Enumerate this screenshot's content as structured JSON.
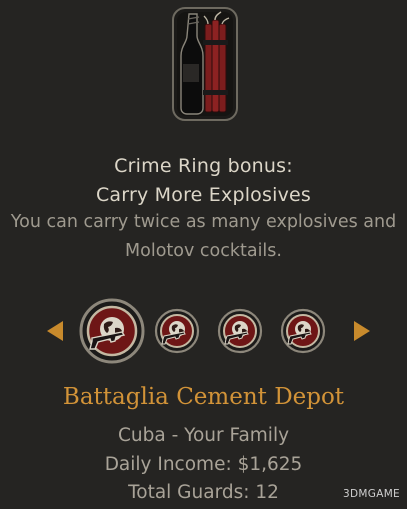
{
  "bonus": {
    "icon": "explosives-icon",
    "title_line1": "Crime Ring bonus:",
    "title_line2": "Carry More Explosives",
    "desc_line1": "You can carry twice as many explosives and",
    "desc_line2": "Molotov cocktails."
  },
  "carousel": {
    "prev_icon": "arrow-left-icon",
    "next_icon": "arrow-right-icon",
    "items": [
      {
        "icon": "racket-globe-gun-icon",
        "selected": true
      },
      {
        "icon": "racket-globe-gun-icon",
        "selected": false
      },
      {
        "icon": "racket-globe-gun-icon",
        "selected": false
      },
      {
        "icon": "racket-globe-gun-icon",
        "selected": false
      }
    ]
  },
  "venue": {
    "name": "Battaglia Cement Depot",
    "owner": "Cuba - Your Family",
    "income": "Daily Income: $1,625",
    "guards": "Total Guards: 12"
  },
  "watermark": "3DMGAME",
  "colors": {
    "background": "#252422",
    "accent_gold": "#d29338",
    "arrow": "#c88a2c",
    "emblem_red": "#6e1616"
  }
}
